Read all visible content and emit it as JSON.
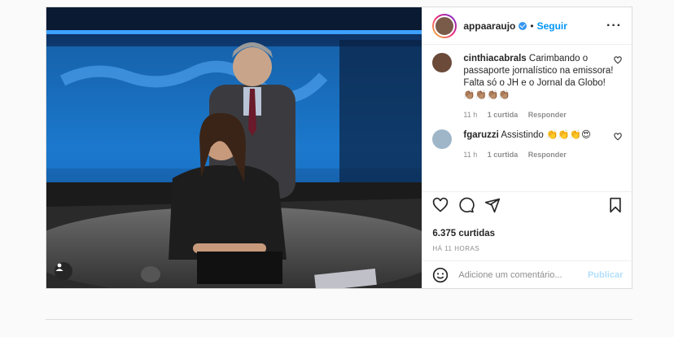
{
  "post": {
    "author": "appaaraujo",
    "verified": true,
    "separator": "•",
    "follow_label": "Seguir",
    "more_icon": "more-options-icon",
    "likes": "6.375 curtidas",
    "time": "HÁ 11 HORAS",
    "comment_placeholder": "Adicione um comentário...",
    "publish_label": "Publicar"
  },
  "comments": [
    {
      "user": "cinthiacabrals",
      "text": "Carimbando o passaporte jornalístico na emissora! Falta só o JH e o Jornal da Globo! 👏🏽👏🏽👏🏽👏🏽",
      "time": "11 h",
      "likes": "1 curtida",
      "reply": "Responder"
    },
    {
      "user": "fgaruzzi",
      "text": "Assistindo 👏👏👏😍",
      "time": "11 h",
      "likes": "1 curtida",
      "reply": "Responder"
    }
  ],
  "colors": {
    "link": "#0095f6",
    "publish_disabled": "#b2dffc",
    "meta": "#8e8e8e"
  }
}
